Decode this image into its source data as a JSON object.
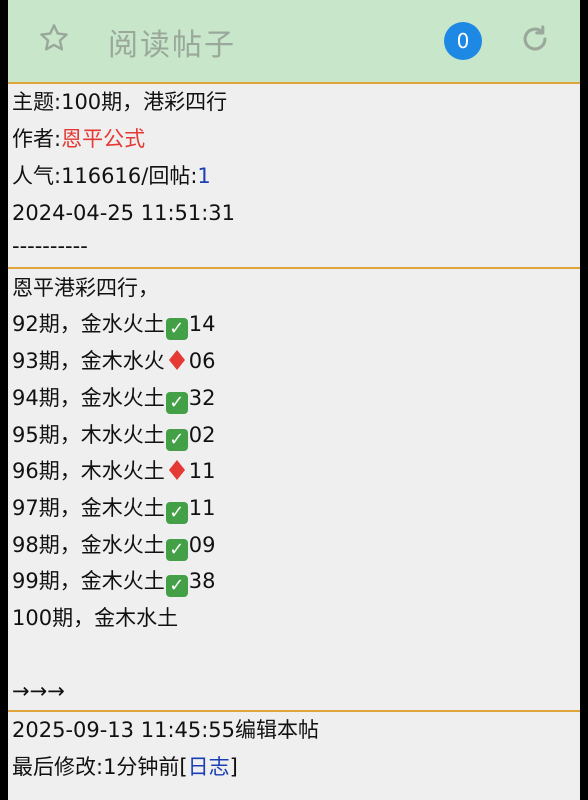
{
  "header": {
    "title": "阅读帖子",
    "badge_count": "0",
    "icons": [
      "star-icon",
      "refresh-icon"
    ]
  },
  "post": {
    "subject_label": "主题:",
    "subject": "100期，港彩四行",
    "author_label": "作者:",
    "author": "恩平公式",
    "popularity_label": "人气:",
    "popularity": "116616",
    "replies_label": "/回帖:",
    "replies": "1",
    "date": "2024-04-25 11:51:31",
    "divider": "----------"
  },
  "body": {
    "intro": "恩平港彩四行，",
    "rows": [
      {
        "period": "92期，金水火土",
        "mark": "check",
        "num": "14"
      },
      {
        "period": "93期，金木水火",
        "mark": "diamond",
        "num": "06"
      },
      {
        "period": "94期，金水火土",
        "mark": "check",
        "num": "32"
      },
      {
        "period": "95期，木水火土",
        "mark": "check",
        "num": "02"
      },
      {
        "period": "96期，木水火土",
        "mark": "diamond",
        "num": "11"
      },
      {
        "period": "97期，金木火土",
        "mark": "check",
        "num": "11"
      },
      {
        "period": "98期，金水火土",
        "mark": "check",
        "num": "09"
      },
      {
        "period": "99期，金木火土",
        "mark": "check",
        "num": "38"
      }
    ],
    "last_row": "100期，金木水土",
    "arrows": "→→→"
  },
  "footer": {
    "edit_line": "2025-09-13 11:45:55编辑本帖",
    "modified_label": "最后修改:1分钟前[",
    "log_link": "日志",
    "modified_close": "]"
  },
  "colors": {
    "header_bg": "#c8e6c9",
    "separator": "#e0a53a",
    "author": "#e53935",
    "link": "#1a3fb5",
    "badge": "#1e88e5",
    "check": "#43a047",
    "diamond": "#e53935"
  }
}
